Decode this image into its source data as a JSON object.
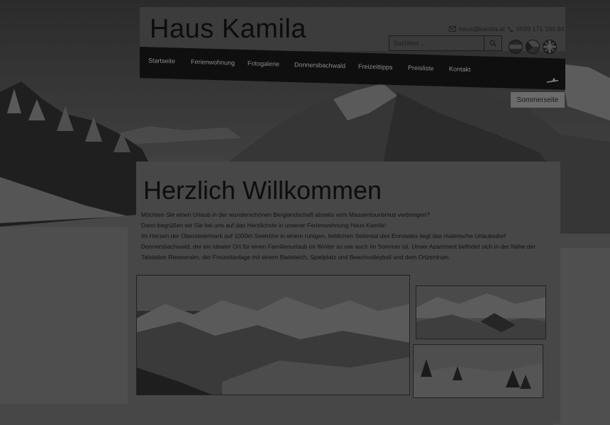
{
  "site": {
    "name": "Haus Kamila",
    "email": "haus@kamila.at",
    "phone": "0699 171 180 84"
  },
  "search": {
    "placeholder": "Suchtext ..."
  },
  "languages": [
    {
      "code": "at",
      "icon": "austria-flag-icon"
    },
    {
      "code": "cz",
      "icon": "czech-flag-icon"
    },
    {
      "code": "en",
      "icon": "uk-flag-icon"
    }
  ],
  "nav": {
    "items": [
      {
        "label": "Startseite"
      },
      {
        "label": "Ferienwohnung"
      },
      {
        "label": "Fotogalerie"
      },
      {
        "label": "Donnersbachwald"
      },
      {
        "label": "Freizeittipps"
      },
      {
        "label": "Preisliste"
      },
      {
        "label": "Kontakt"
      }
    ]
  },
  "season_button": "Sommerseite",
  "main": {
    "heading": "Herzlich Willkommen",
    "paragraphs": [
      "Möchten Sie einen Urlaub in der wunderschönen Berglandschaft abseits vom Massentourismus verbringen?",
      "Dann begrüßen wir Sie bei uns auf das Herzlichste in unserer Ferienwohnung Haus Kamila!",
      "Im Herzen der Obersteiermark auf 1000m Seehöhe in einem ruhigen, lieblichen Seitental des Ennstales liegt das malerische Urlaubsdorf",
      "Donnersbachwald, der ein idealer Ort für einen Familienurlaub im Winter so wie auch im Sommer ist. Unser Apartment befindet sich in der Nähe der",
      "Talstation Riesneralm, der Freizeitanlage mit einem Badeteich, Spielplatz und Beachvolleyball und dem Ortzentrum."
    ]
  },
  "colors": {
    "nav_bg": "#0f0f0f",
    "page_bg": "#3a3a3a",
    "text": "#0d0d0d"
  }
}
